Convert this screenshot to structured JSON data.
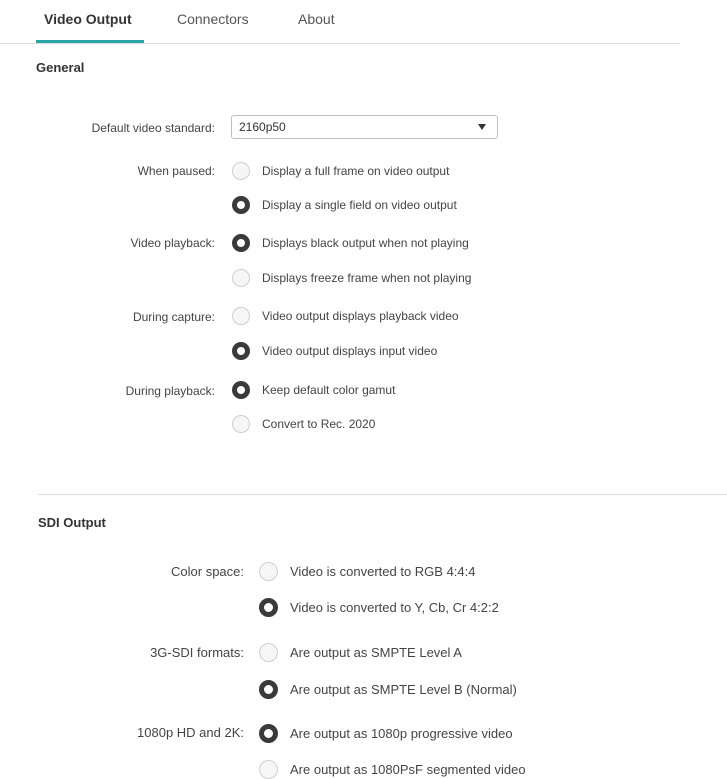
{
  "tabs": [
    {
      "label": "Video Output",
      "active": true
    },
    {
      "label": "Connectors",
      "active": false
    },
    {
      "label": "About",
      "active": false
    }
  ],
  "general": {
    "title": "General",
    "default_standard": {
      "label": "Default video standard:",
      "value": "2160p50"
    },
    "when_paused": {
      "label": "When paused:",
      "options": [
        "Display a full frame on video output",
        "Display a single field on video output"
      ],
      "selected": 1
    },
    "video_playback": {
      "label": "Video playback:",
      "options": [
        "Displays black output when not playing",
        "Displays freeze frame when not playing"
      ],
      "selected": 0
    },
    "during_capture": {
      "label": "During capture:",
      "options": [
        "Video output displays playback video",
        "Video output displays input video"
      ],
      "selected": 1
    },
    "during_playback": {
      "label": "During playback:",
      "options": [
        "Keep default color gamut",
        "Convert to Rec. 2020"
      ],
      "selected": 0
    }
  },
  "sdi": {
    "title": "SDI Output",
    "color_space": {
      "label": "Color space:",
      "options": [
        "Video is converted to RGB 4:4:4",
        "Video is converted to Y, Cb, Cr 4:2:2"
      ],
      "selected": 1
    },
    "sdi_formats": {
      "label": "3G-SDI formats:",
      "options": [
        "Are output as SMPTE Level A",
        "Are output as SMPTE Level B (Normal)"
      ],
      "selected": 1
    },
    "hd_2k": {
      "label": "1080p HD and 2K:",
      "options": [
        "Are output as 1080p progressive video",
        "Are output as 1080PsF segmented video"
      ],
      "selected": 0
    }
  },
  "colors": {
    "accent": "#2aa6a6",
    "radio_selected": "#3a3a3a"
  }
}
